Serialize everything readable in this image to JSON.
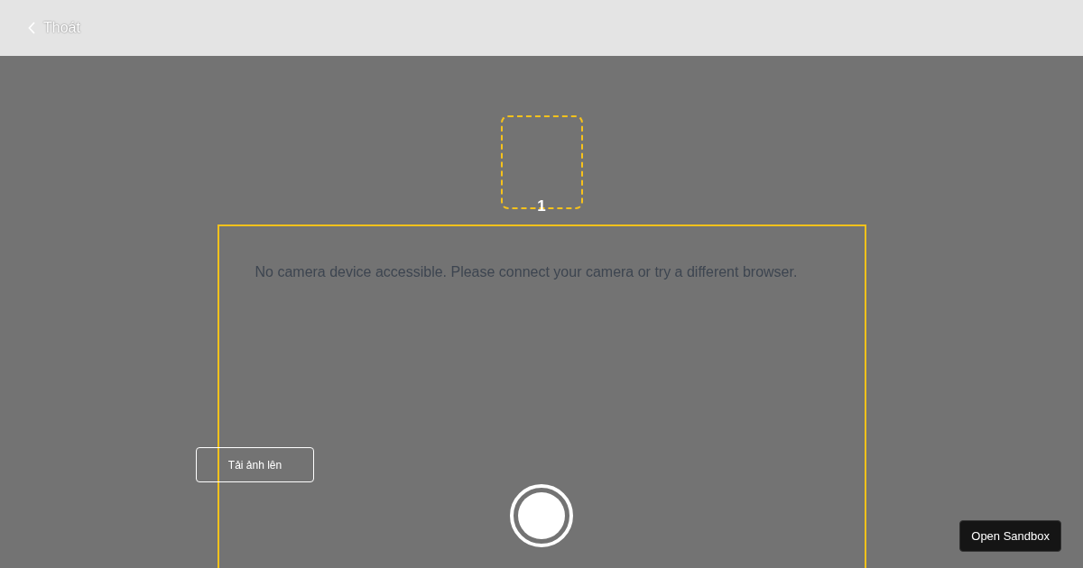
{
  "header": {
    "back_label": "Thoát"
  },
  "thumbnails": [
    {
      "label": "1"
    }
  ],
  "camera": {
    "message": "No camera device accessible. Please connect your camera or try a different browser."
  },
  "upload_button": {
    "label": "Tải ảnh lên"
  },
  "sandbox_button": {
    "label": "Open Sandbox"
  }
}
